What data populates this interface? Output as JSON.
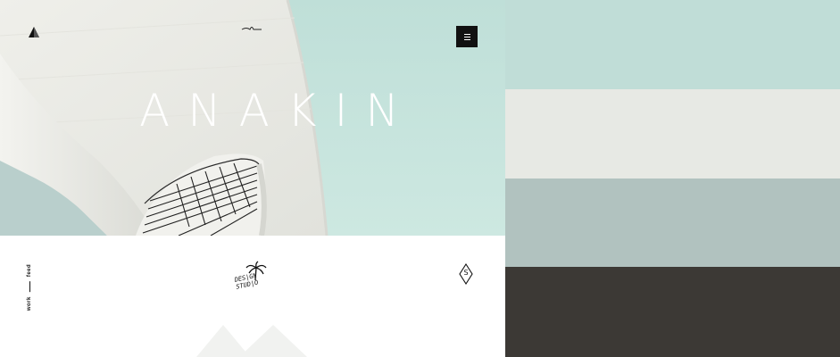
{
  "hero": {
    "title": "ANAKIN",
    "sky_color": "#c2e1da",
    "building_color": "#ebebe6"
  },
  "header": {
    "logo_icon": "triangle-logo-icon",
    "signature_icon": "signature-mark-icon",
    "menu_icon": "hamburger-menu-icon"
  },
  "side_nav": {
    "links": [
      "work",
      "feed"
    ]
  },
  "studio_logo": {
    "icon": "palm-tree-icon",
    "line1": "DES|GN",
    "line2": "STUD|O"
  },
  "badge": {
    "icon": "diamond-icon",
    "letter": "S"
  },
  "palette": [
    {
      "name": "mint",
      "color": "#c0ddd7"
    },
    {
      "name": "off-white",
      "color": "#e7e9e4"
    },
    {
      "name": "sage-gray",
      "color": "#b1c2bf"
    },
    {
      "name": "charcoal",
      "color": "#3c3935"
    }
  ]
}
